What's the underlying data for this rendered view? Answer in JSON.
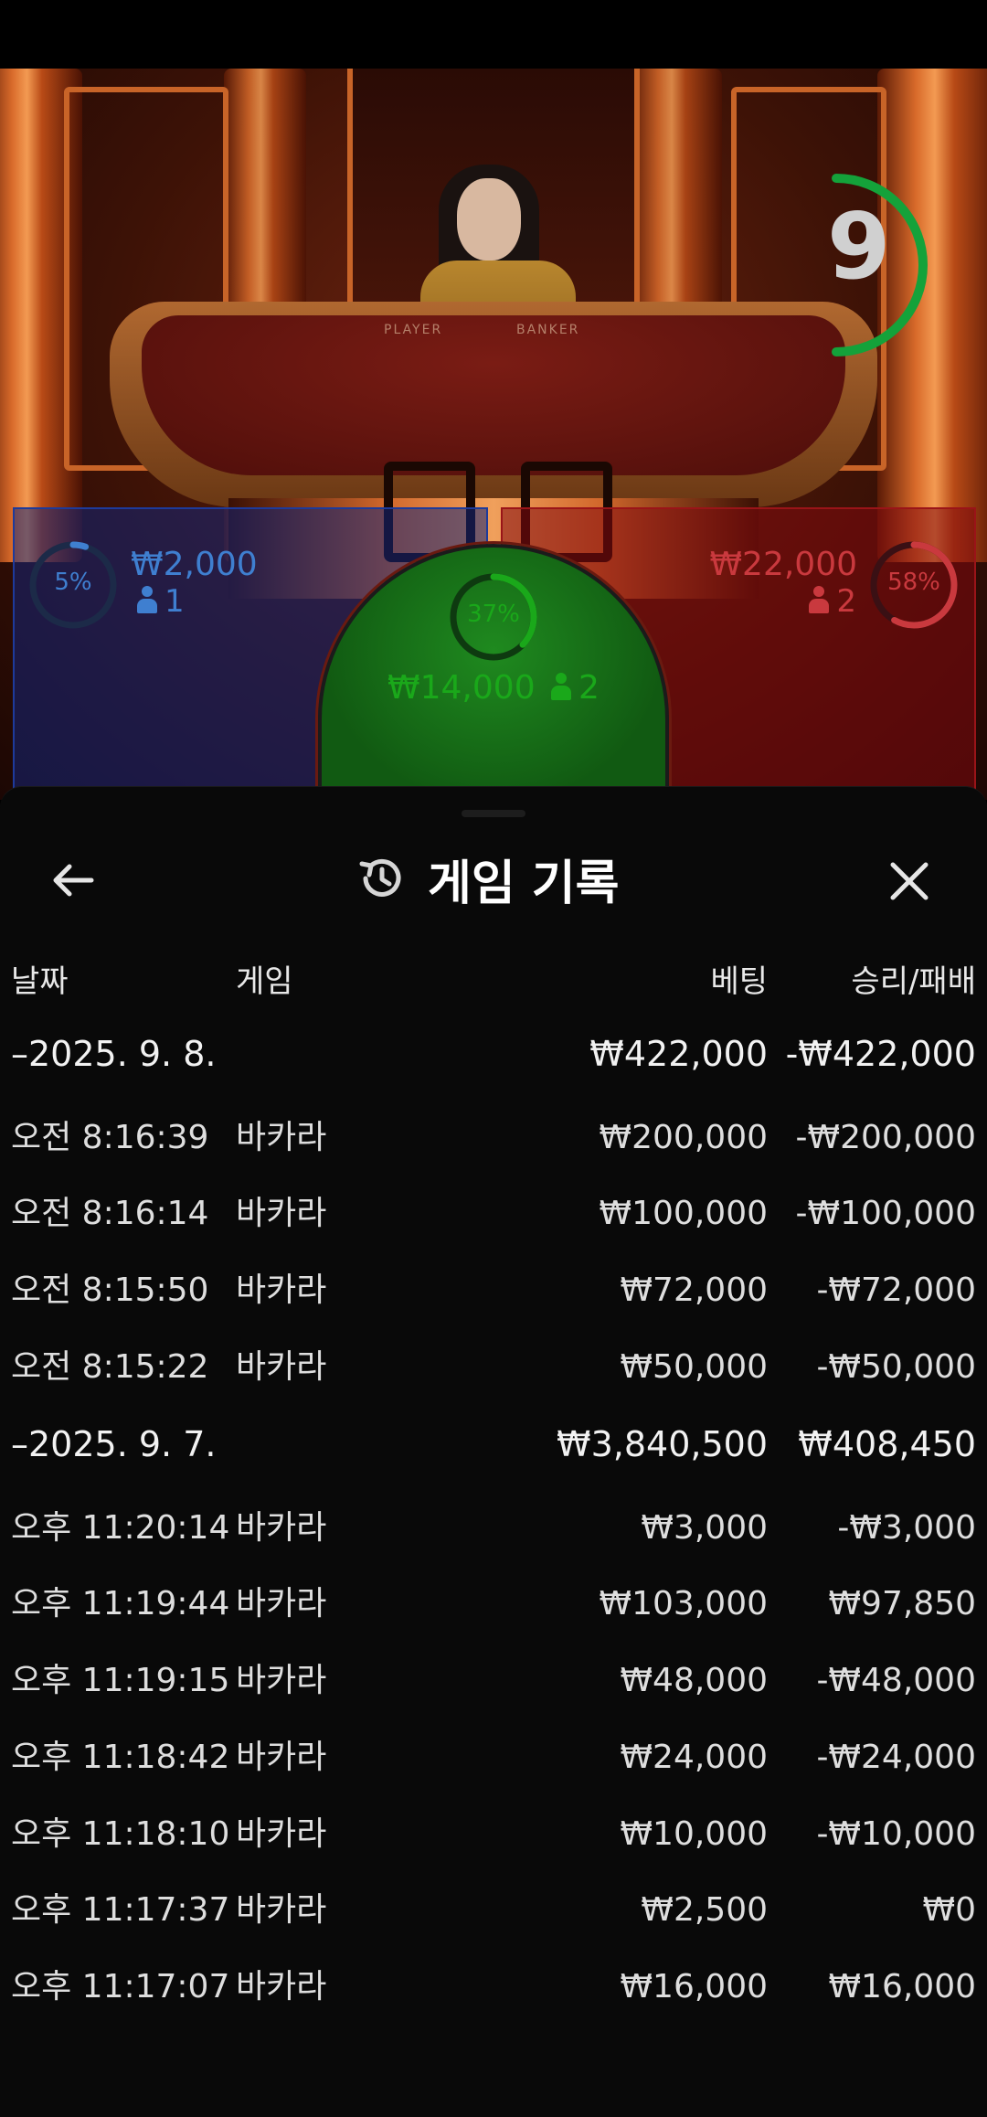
{
  "countdown": {
    "value": "9"
  },
  "bets": {
    "player": {
      "percent": "5%",
      "percent_value": 5,
      "amount": "₩2,000",
      "players": "1",
      "color": "#3f7fd0"
    },
    "tie": {
      "percent": "37%",
      "percent_value": 37,
      "amount": "₩14,000",
      "players": "2",
      "color": "#1aa81a"
    },
    "banker": {
      "percent": "58%",
      "percent_value": 58,
      "amount": "₩22,000",
      "players": "2",
      "color": "#c9393e"
    }
  },
  "table": {
    "player_label": "PLAYER",
    "banker_label": "BANKER"
  },
  "sheet": {
    "title": "게임 기록",
    "columns": {
      "date": "날짜",
      "game": "게임",
      "bet": "베팅",
      "result": "승리/패배"
    },
    "groups": [
      {
        "date": "–2025. 9. 8.",
        "bet": "₩422,000",
        "result": "-₩422,000",
        "rows": [
          {
            "time": "오전 8:16:39",
            "game": "바카라",
            "bet": "₩200,000",
            "result": "-₩200,000"
          },
          {
            "time": "오전 8:16:14",
            "game": "바카라",
            "bet": "₩100,000",
            "result": "-₩100,000"
          },
          {
            "time": "오전 8:15:50",
            "game": "바카라",
            "bet": "₩72,000",
            "result": "-₩72,000"
          },
          {
            "time": "오전 8:15:22",
            "game": "바카라",
            "bet": "₩50,000",
            "result": "-₩50,000"
          }
        ]
      },
      {
        "date": "–2025. 9. 7.",
        "bet": "₩3,840,500",
        "result": "₩408,450",
        "rows": [
          {
            "time": "오후 11:20:14",
            "game": "바카라",
            "bet": "₩3,000",
            "result": "-₩3,000"
          },
          {
            "time": "오후 11:19:44",
            "game": "바카라",
            "bet": "₩103,000",
            "result": "₩97,850"
          },
          {
            "time": "오후 11:19:15",
            "game": "바카라",
            "bet": "₩48,000",
            "result": "-₩48,000"
          },
          {
            "time": "오후 11:18:42",
            "game": "바카라",
            "bet": "₩24,000",
            "result": "-₩24,000"
          },
          {
            "time": "오후 11:18:10",
            "game": "바카라",
            "bet": "₩10,000",
            "result": "-₩10,000"
          },
          {
            "time": "오후 11:17:37",
            "game": "바카라",
            "bet": "₩2,500",
            "result": "₩0"
          },
          {
            "time": "오후 11:17:07",
            "game": "바카라",
            "bet": "₩16,000",
            "result": "₩16,000"
          }
        ]
      }
    ]
  }
}
